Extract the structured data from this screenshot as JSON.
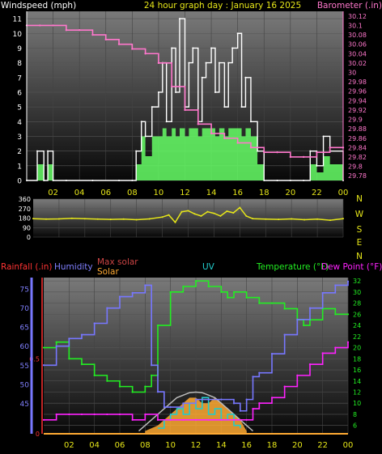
{
  "title": "24 hour graph day : January 16 2025",
  "colors": {
    "wind": "#ffffff",
    "gust_fill": "#66ff66",
    "barometer": "#ff77cc",
    "direction": "#e6e619",
    "humidity": "#7777ff",
    "temperature": "#22ee22",
    "dewpoint": "#ff22ff",
    "solar": "#ffaa33",
    "maxsolar": "#bbbbbb",
    "uv": "#22cccc",
    "rain": "#ff3333"
  },
  "chart_data": [
    {
      "type": "line",
      "name": "wind-barometer",
      "labels": {
        "left": "Windspeed (mph)",
        "right": "Barometer (.in)"
      },
      "x_ticks": [
        "02",
        "04",
        "06",
        "08",
        "10",
        "12",
        "14",
        "16",
        "18",
        "20",
        "22",
        "00"
      ],
      "ylim_left": [
        0,
        11.5
      ],
      "yticks_left": [
        "0",
        "1",
        "2",
        "3",
        "4",
        "5",
        "6",
        "7",
        "8",
        "9",
        "10",
        "11"
      ],
      "ylim_right": [
        29.77,
        30.13
      ],
      "yticks_right": [
        "29.78",
        "29.8",
        "29.82",
        "29.84",
        "29.86",
        "29.88",
        "29.9",
        "29.92",
        "29.94",
        "29.96",
        "29.98",
        "30",
        "30.02",
        "30.04",
        "30.06",
        "30.08",
        "30.1",
        "30.12"
      ],
      "series": [
        {
          "name": "Windspeed",
          "x": [
            0,
            0.8,
            1.3,
            1.6,
            2,
            3,
            5,
            7,
            8,
            8.3,
            8.7,
            9,
            9.5,
            10,
            10.3,
            10.6,
            11,
            11.3,
            11.6,
            12,
            12.3,
            12.6,
            13,
            13.3,
            13.6,
            14,
            14.3,
            14.6,
            15,
            15.3,
            15.6,
            16,
            16.3,
            16.6,
            17,
            17.5,
            18,
            19,
            20,
            21,
            21.5,
            22,
            22.5,
            23,
            24
          ],
          "y": [
            0,
            2,
            0,
            2,
            0,
            0,
            0,
            0,
            0,
            2,
            4,
            3,
            5,
            6,
            8,
            4,
            9,
            6,
            11,
            5,
            8,
            9,
            4,
            7,
            8,
            9,
            6,
            8,
            5,
            8,
            9,
            10,
            5,
            7,
            4,
            2,
            0,
            0,
            0,
            0,
            2,
            1,
            3,
            2,
            0
          ]
        },
        {
          "name": "Barometer",
          "x": [
            0,
            1,
            2,
            3,
            4,
            5,
            6,
            7,
            8,
            9,
            10,
            11,
            12,
            13,
            14,
            15,
            16,
            17,
            18,
            19,
            20,
            21,
            22,
            23,
            24
          ],
          "y": [
            30.1,
            30.1,
            30.1,
            30.09,
            30.09,
            30.08,
            30.07,
            30.06,
            30.05,
            30.04,
            30.02,
            29.97,
            29.92,
            29.89,
            29.87,
            29.86,
            29.85,
            29.84,
            29.83,
            29.83,
            29.82,
            29.82,
            29.83,
            29.84,
            29.84
          ]
        }
      ]
    },
    {
      "type": "line",
      "name": "wind-direction",
      "y_ticks_left": [
        "360",
        "270",
        "180",
        "90",
        "0"
      ],
      "ylim": [
        0,
        360
      ],
      "compass_labels": [
        "N",
        "W",
        "S",
        "E",
        "N"
      ],
      "series": [
        {
          "name": "Wind direction",
          "x": [
            0,
            1,
            2,
            3,
            4,
            5,
            6,
            7,
            8,
            9,
            10,
            10.5,
            11,
            11.5,
            12,
            12.5,
            13,
            13.5,
            14,
            14.5,
            15,
            15.5,
            16,
            16.5,
            17,
            18,
            19,
            20,
            21,
            22,
            23,
            24
          ],
          "y": [
            175,
            170,
            172,
            178,
            174,
            170,
            168,
            170,
            165,
            172,
            190,
            210,
            140,
            240,
            250,
            220,
            200,
            240,
            225,
            200,
            245,
            230,
            280,
            200,
            175,
            170,
            168,
            172,
            165,
            170,
            160,
            175
          ]
        }
      ]
    },
    {
      "type": "line",
      "name": "temperature-humidity",
      "labels": {
        "rain": "Rainfall (.in)",
        "humidity": "Humidity",
        "maxsolar": "Max solar",
        "solar": "Solar",
        "uv": "UV",
        "temperature": "Temperature (°F)",
        "dewpoint": "Dew Point (°F)"
      },
      "x_ticks": [
        "02",
        "04",
        "06",
        "08",
        "10",
        "12",
        "14",
        "16",
        "18",
        "20",
        "22",
        "00"
      ],
      "yticks_rain": [
        "0",
        "0.5"
      ],
      "yticks_humidity": [
        "45",
        "50",
        "55",
        "60",
        "65",
        "70",
        "75"
      ],
      "ylim_humidity": [
        37,
        78
      ],
      "yticks_temperature": [
        "6",
        "8",
        "10",
        "12",
        "14",
        "16",
        "18",
        "20",
        "22",
        "24",
        "26",
        "28",
        "30",
        "32"
      ],
      "ylim_temperature": [
        4.5,
        32.6
      ],
      "series": [
        {
          "name": "Humidity",
          "x": [
            0,
            1,
            2,
            3,
            4,
            5,
            6,
            7,
            8,
            8.5,
            9,
            9.5,
            10,
            11,
            12,
            13,
            14,
            15,
            15.5,
            16,
            16.5,
            17,
            18,
            19,
            20,
            21,
            22,
            23,
            24
          ],
          "y": [
            55,
            60,
            62,
            63,
            66,
            70,
            73,
            74,
            76,
            55,
            48,
            44,
            44,
            45,
            46,
            46,
            46,
            45,
            43,
            46,
            52,
            53,
            58,
            63,
            67,
            70,
            74,
            76,
            77
          ]
        },
        {
          "name": "Temperature",
          "x": [
            0,
            1,
            2,
            3,
            4,
            5,
            6,
            7,
            8,
            8.5,
            9,
            10,
            11,
            12,
            13,
            14,
            14.5,
            15,
            16,
            17,
            18,
            19,
            20,
            20.5,
            21,
            22,
            23,
            24
          ],
          "y": [
            20,
            21,
            18,
            17,
            15,
            14,
            13,
            12,
            13,
            15,
            24,
            30,
            31,
            32,
            31,
            30,
            29,
            30,
            29,
            28,
            28,
            27,
            25,
            24,
            25,
            27,
            26,
            26
          ]
        },
        {
          "name": "Dew Point",
          "x": [
            0,
            1,
            2,
            3,
            4,
            5,
            6,
            7,
            8,
            9,
            10,
            11,
            12,
            13,
            14,
            15,
            16,
            16.5,
            17,
            18,
            19,
            20,
            21,
            22,
            23,
            24
          ],
          "y": [
            7,
            8,
            8,
            8,
            8,
            8,
            8,
            7,
            8,
            7,
            7,
            7,
            7,
            7,
            7,
            7,
            7,
            9,
            10,
            11,
            13,
            15,
            17,
            19,
            20,
            21
          ]
        },
        {
          "name": "Max solar",
          "x": [
            7.5,
            8.5,
            9.5,
            10.5,
            11.5,
            12,
            12.5,
            13.5,
            14.5,
            15.5,
            16.5
          ],
          "y": [
            5,
            7,
            9,
            11,
            11.9,
            12,
            11.9,
            11,
            9,
            7,
            5
          ]
        },
        {
          "name": "Solar",
          "x": [
            8,
            9,
            10,
            10.5,
            11,
            11.5,
            12,
            12.5,
            13,
            13.5,
            14,
            14.5,
            15,
            15.5,
            16
          ],
          "y": [
            5,
            6,
            8,
            9,
            10,
            11,
            11,
            10,
            10,
            11,
            10,
            9,
            8,
            7,
            5
          ]
        },
        {
          "name": "UV",
          "x": [
            9,
            9.5,
            10,
            10.5,
            11,
            11.5,
            12,
            12.5,
            13,
            13.5,
            14,
            14.5,
            15,
            15.5
          ],
          "y": [
            5.5,
            7,
            8,
            9,
            8,
            10,
            9,
            11,
            8,
            9,
            7,
            8,
            6,
            5.5
          ]
        }
      ]
    }
  ]
}
